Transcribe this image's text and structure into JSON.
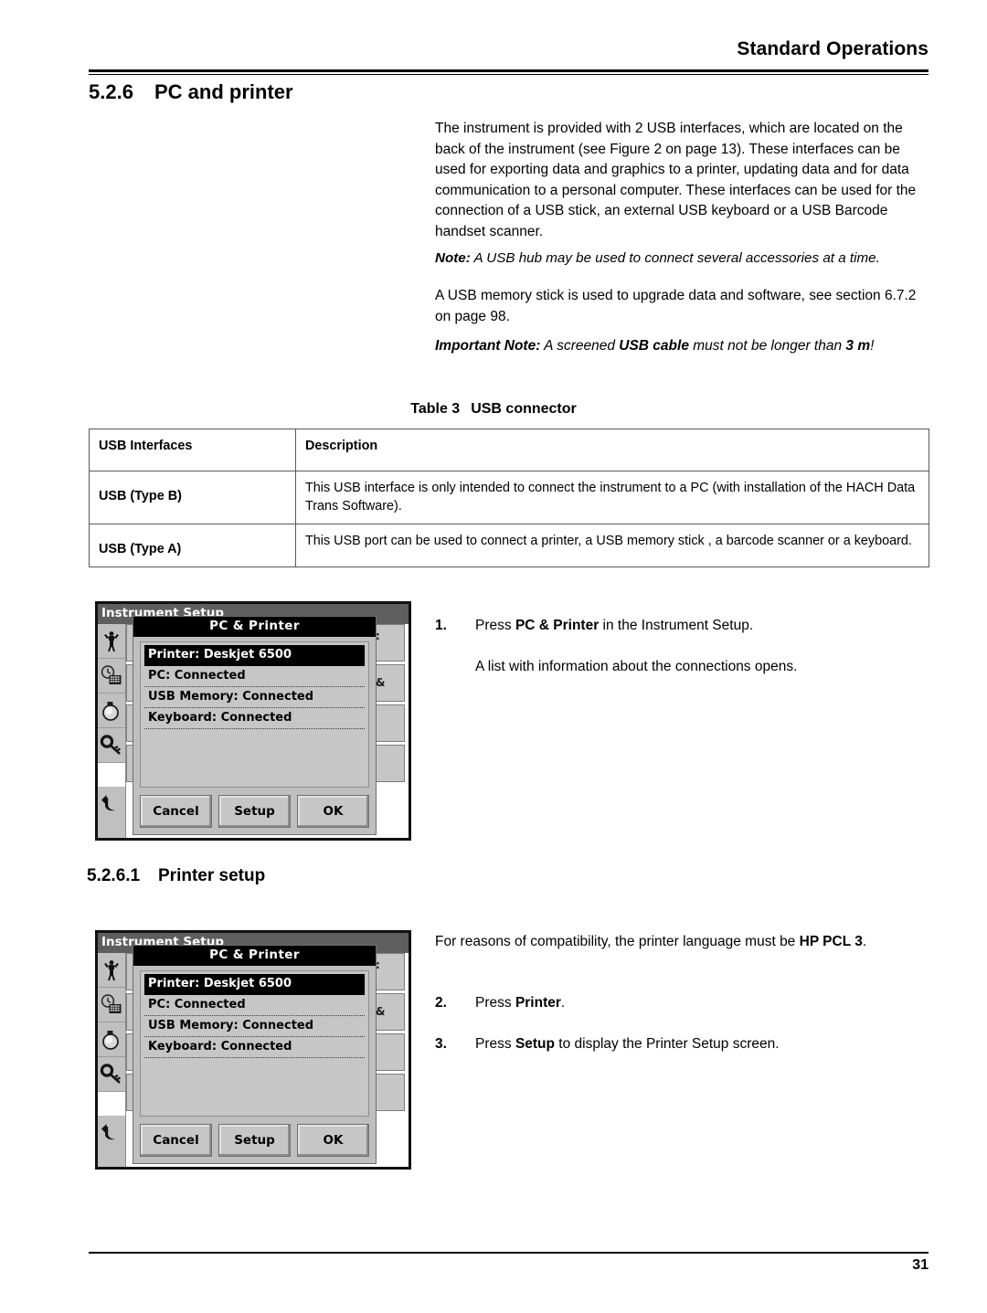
{
  "header": {
    "running_title": "Standard Operations"
  },
  "footer": {
    "page_number": "31"
  },
  "section": {
    "number": "5.2.6",
    "title": "PC and printer",
    "sub_number": "5.2.6.1",
    "sub_title": "Printer setup"
  },
  "body": {
    "para1": "The instrument is provided with 2 USB interfaces, which are located on the back of the instrument (see Figure 2 on page 13). These interfaces can be used for exporting data and graphics to a printer, updating data and for data communication to a personal computer. These interfaces can be used for the connection of a USB stick, an external USB keyboard or a USB Barcode handset scanner.",
    "note_label": "Note:",
    "note_text": " A USB hub may be used to connect several accessories at a time.",
    "para2": "A USB memory stick is used to upgrade data and software, see section 6.7.2 on page 98.",
    "important_label": "Important Note:",
    "important_text_1": " A screened ",
    "important_bold_1": "USB cable",
    "important_text_2": " must not be longer than ",
    "important_bold_2": "3 m",
    "important_text_3": "!"
  },
  "table": {
    "caption_label": "Table 3",
    "caption_title": "USB connector",
    "columns": [
      "USB Interfaces",
      "Description"
    ],
    "rows": [
      {
        "interface": "USB (Type B)",
        "description": "This USB interface is only intended to connect the instrument to a PC (with installation of the HACH Data Trans Software)."
      },
      {
        "interface": "USB (Type A)",
        "description": "This USB port can be used to connect a printer, a USB memory stick , a barcode scanner or a keyboard."
      }
    ]
  },
  "steps_block_1": [
    {
      "number": "1.",
      "text_before": "Press ",
      "bold": "PC & Printer",
      "text_after": " in the Instrument Setup.",
      "followup": "A list with information about the connections opens."
    }
  ],
  "steps_block_2": {
    "intro_text": "For reasons of compatibility, the printer language must be ",
    "intro_bold": "HP PCL 3",
    "intro_tail": ".",
    "items": [
      {
        "number": "2.",
        "text_before": "Press ",
        "bold": "Printer",
        "text_after": "."
      },
      {
        "number": "3.",
        "text_before": "Press ",
        "bold": "Setup",
        "text_after": " to display the Printer Setup screen."
      }
    ]
  },
  "device_screen": {
    "window_title": "Instrument Setup",
    "dialog_title": "PC & Printer",
    "list_items": [
      {
        "label": "Printer: Deskjet 6500",
        "selected": true
      },
      {
        "label": "PC: Connected",
        "selected": false
      },
      {
        "label": "USB Memory: Connected",
        "selected": false
      },
      {
        "label": "Keyboard: Connected",
        "selected": false
      }
    ],
    "buttons": [
      "Cancel",
      "Setup",
      "OK"
    ],
    "rail_icons": [
      "operator-id-icon",
      "date-time-icon",
      "display-sound-icon",
      "password-icon",
      "back-arrow-icon"
    ],
    "background_fragments": [
      ": ",
      "&"
    ],
    "colors": {
      "title_bar": "#5e5e5e",
      "dialog_title_bar": "#000000",
      "selection": "#000000",
      "panel": "#bfbfbf",
      "button_face": "#c6c6c6"
    }
  }
}
